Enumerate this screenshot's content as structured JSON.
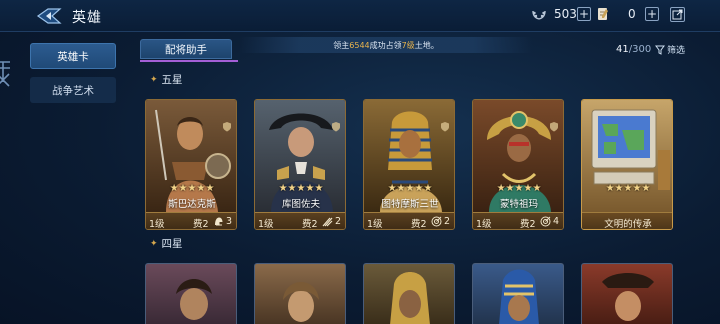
{
  "header": {
    "title": "英雄",
    "resources": [
      {
        "icon": "laurel-icon",
        "value": "503"
      },
      {
        "icon": "document-icon",
        "value": "0"
      }
    ]
  },
  "sidebar": {
    "items": [
      {
        "label": "英雄卡",
        "active": true
      },
      {
        "label": "战争艺术",
        "active": false
      }
    ]
  },
  "subheader": {
    "tab_label": "配将助手",
    "notice": {
      "prefix": "领主",
      "id": "6544",
      "middle": "成功占领",
      "level": "7级",
      "suffix": "土地。"
    },
    "count": {
      "current": "41",
      "total": "/300"
    },
    "filter_label": "筛选"
  },
  "sections": {
    "five_star": "五星",
    "four_star": "四星"
  },
  "cards": [
    {
      "name": "斯巴达克斯",
      "stars": "★★★★★",
      "level": "1级",
      "cost": "费2",
      "skill_icon": "helmet-icon",
      "skill_count": "3"
    },
    {
      "name": "库图佐夫",
      "stars": "★★★★★",
      "level": "1级",
      "cost": "费2",
      "skill_icon": "slash-icon",
      "skill_count": "2"
    },
    {
      "name": "图特摩斯三世",
      "stars": "★★★★★",
      "level": "1级",
      "cost": "费2",
      "skill_icon": "target-icon",
      "skill_count": "2"
    },
    {
      "name": "蒙特祖玛",
      "stars": "★★★★★",
      "level": "1级",
      "cost": "费2",
      "skill_icon": "target-icon",
      "skill_count": "4"
    }
  ],
  "special_card": {
    "stars": "★★★★★",
    "title": "文明的传承"
  },
  "colors": {
    "accent_gold": "#e9b44c",
    "tab_blue": "#2c5b8f",
    "underline_purple": "#a45fd6"
  }
}
